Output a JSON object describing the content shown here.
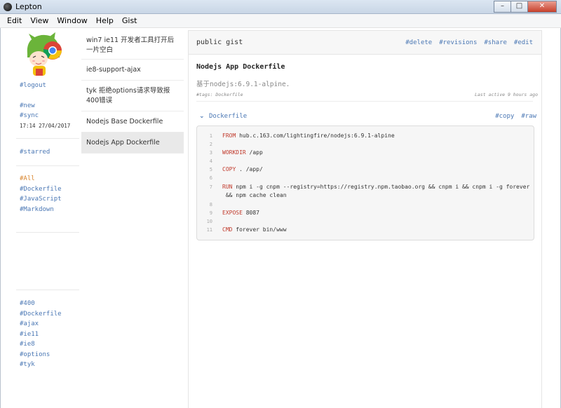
{
  "window": {
    "title": "Lepton",
    "buttons": {
      "minimize": "–",
      "maximize": "□",
      "close": "✕"
    }
  },
  "menu": [
    "Edit",
    "View",
    "Window",
    "Help",
    "Gist"
  ],
  "sidebar": {
    "logout": "#logout",
    "new": "#new",
    "sync": "#sync",
    "sync_time": "17:14 27/04/2017",
    "starred": "#starred",
    "languages": [
      {
        "label": "#All",
        "active": true
      },
      {
        "label": "#Dockerfile",
        "active": false
      },
      {
        "label": "#JavaScript",
        "active": false
      },
      {
        "label": "#Markdown",
        "active": false
      }
    ],
    "tags": [
      "#400",
      "#Dockerfile",
      "#ajax",
      "#ie11",
      "#ie8",
      "#options",
      "#tyk"
    ]
  },
  "gists": [
    {
      "title": "win7 ie11 开发者工具打开后一片空白",
      "selected": false
    },
    {
      "title": "ie8-support-ajax",
      "selected": false
    },
    {
      "title": "tyk 拒绝options请求导致报400错误",
      "selected": false
    },
    {
      "title": "Nodejs Base Dockerfile",
      "selected": false
    },
    {
      "title": "Nodejs App Dockerfile",
      "selected": true
    }
  ],
  "detail": {
    "visibility": "public gist",
    "actions": [
      "#delete",
      "#revisions",
      "#share",
      "#edit"
    ],
    "title": "Nodejs App Dockerfile",
    "description": "基于nodejs:6.9.1-alpine.",
    "tags_line": "#tags: Dockerfile",
    "last_active": "Last active 9 hours ago",
    "file": {
      "name": "Dockerfile",
      "actions": [
        "#copy",
        "#raw"
      ],
      "lines": [
        {
          "num": "1",
          "keyword": "FROM",
          "rest": " hub.c.163.com/lightingfire/nodejs:6.9.1-alpine"
        },
        {
          "num": "2",
          "keyword": "",
          "rest": ""
        },
        {
          "num": "3",
          "keyword": "WORKDIR",
          "rest": " /app"
        },
        {
          "num": "4",
          "keyword": "",
          "rest": ""
        },
        {
          "num": "5",
          "keyword": "COPY",
          "rest": " . /app/"
        },
        {
          "num": "6",
          "keyword": "",
          "rest": ""
        },
        {
          "num": "7",
          "keyword": "RUN",
          "rest": " npm i -g cnpm --registry=https://registry.npm.taobao.org && cnpm i && cnpm i -g forever"
        },
        {
          "num": "",
          "keyword": "",
          "rest": " && npm cache clean"
        },
        {
          "num": "8",
          "keyword": "",
          "rest": ""
        },
        {
          "num": "9",
          "keyword": "EXPOSE",
          "rest": " 8087"
        },
        {
          "num": "10",
          "keyword": "",
          "rest": ""
        },
        {
          "num": "11",
          "keyword": "CMD",
          "rest": " forever bin/www"
        }
      ]
    }
  },
  "colors": {
    "link": "#4a77b4",
    "active": "#d8842c",
    "keyword": "#c0392b"
  }
}
